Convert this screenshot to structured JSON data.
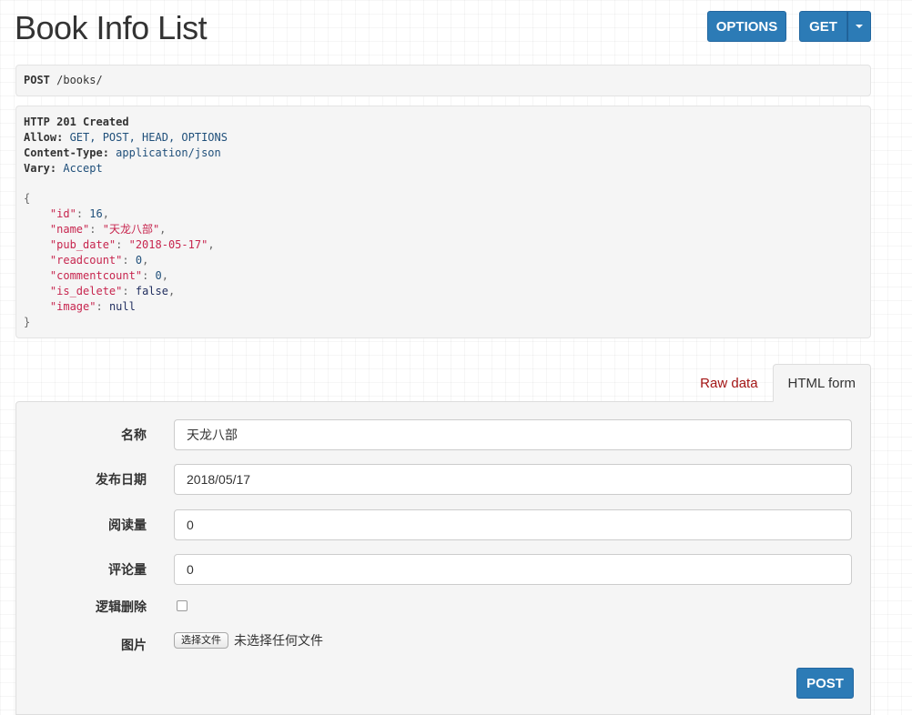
{
  "header": {
    "title": "Book Info List",
    "options_label": "OPTIONS",
    "get_label": "GET"
  },
  "request": {
    "method": "POST",
    "path": " /books/"
  },
  "response": {
    "status": "HTTP 201 Created",
    "headers": [
      {
        "key": "Allow:",
        "value": " GET, POST, HEAD, OPTIONS"
      },
      {
        "key": "Content-Type:",
        "value": " application/json"
      },
      {
        "key": "Vary:",
        "value": " Accept"
      }
    ],
    "open_brace": "{",
    "close_brace": "}",
    "fields": [
      {
        "key": "\"id\"",
        "value": "16",
        "kind": "num",
        "comma": ","
      },
      {
        "key": "\"name\"",
        "value": "\"天龙八部\"",
        "kind": "str",
        "comma": ","
      },
      {
        "key": "\"pub_date\"",
        "value": "\"2018-05-17\"",
        "kind": "str",
        "comma": ","
      },
      {
        "key": "\"readcount\"",
        "value": "0",
        "kind": "num",
        "comma": ","
      },
      {
        "key": "\"commentcount\"",
        "value": "0",
        "kind": "num",
        "comma": ","
      },
      {
        "key": "\"is_delete\"",
        "value": "false",
        "kind": "lit",
        "comma": ","
      },
      {
        "key": "\"image\"",
        "value": "null",
        "kind": "lit",
        "comma": ""
      }
    ]
  },
  "tabs": {
    "raw": "Raw data",
    "html": "HTML form"
  },
  "form": {
    "name_label": "名称",
    "name_value": "天龙八部",
    "date_label": "发布日期",
    "date_value": "2018/05/17",
    "readcount_label": "阅读量",
    "readcount_value": "0",
    "commentcount_label": "评论量",
    "commentcount_value": "0",
    "delete_label": "逻辑删除",
    "image_label": "图片",
    "file_button": "选择文件",
    "file_status": "未选择任何文件",
    "submit_label": "POST"
  }
}
